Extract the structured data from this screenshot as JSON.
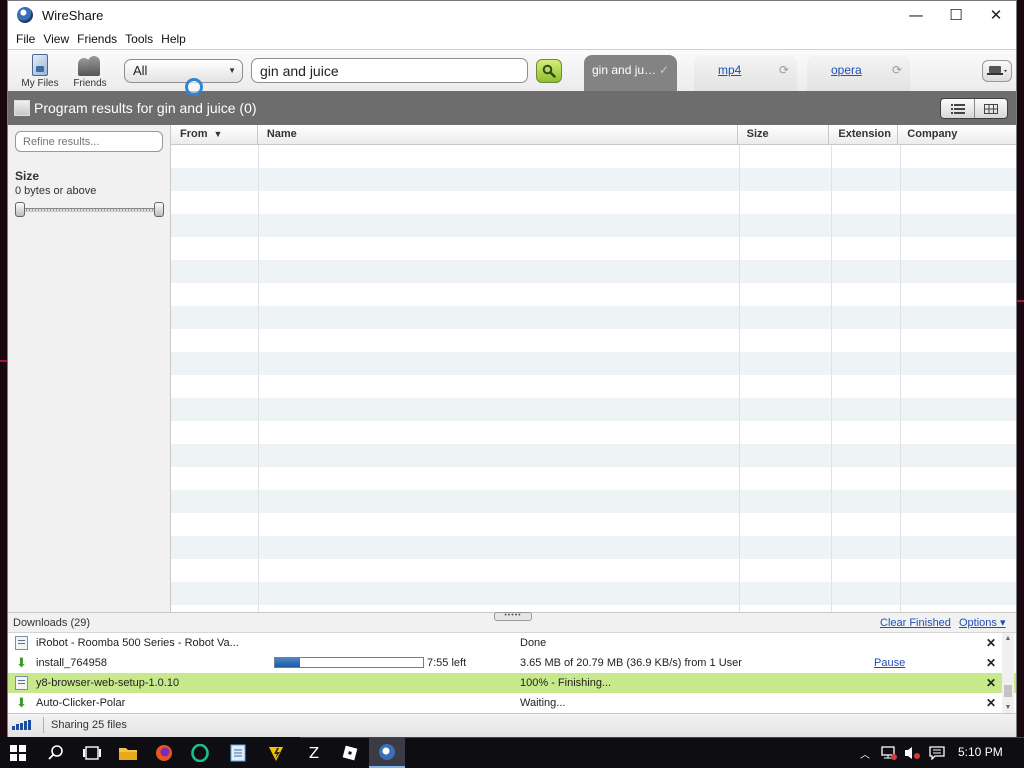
{
  "window": {
    "title": "WireShare",
    "controls": {
      "minimize": "—",
      "maximize": "☐",
      "close": "✕"
    }
  },
  "menu": [
    "File",
    "View",
    "Friends",
    "Tools",
    "Help"
  ],
  "toolbar": {
    "my_files_label": "My Files",
    "friends_label": "Friends",
    "category_value": "All",
    "search_value": "gin and juice",
    "tabs": [
      {
        "label": "gin and ju…",
        "status": "✓",
        "active": true
      },
      {
        "label": "mp4",
        "status": "⟳",
        "active": false
      },
      {
        "label": "opera",
        "status": "⟳",
        "active": false
      }
    ]
  },
  "results": {
    "title": "Program results for gin and juice (0)"
  },
  "filters": {
    "refine_placeholder": "Refine results...",
    "size_title": "Size",
    "size_subtitle": "0 bytes or above"
  },
  "table": {
    "columns": [
      {
        "label": "From",
        "sorted": true,
        "sort_glyph": "▼"
      },
      {
        "label": "Name"
      },
      {
        "label": "Size"
      },
      {
        "label": "Extension"
      },
      {
        "label": "Company"
      }
    ],
    "rows": []
  },
  "downloads": {
    "title": "Downloads (29)",
    "grip": "•••••",
    "clear_finished": "Clear Finished",
    "options": "Options ▾",
    "items": [
      {
        "name": "iRobot - Roomba 500 Series - Robot Va...",
        "status": "Done",
        "icon": "document-icon",
        "close": "✕"
      },
      {
        "name": "install_764958",
        "status": "3.65 MB of 20.79 MB (36.9 KB/s) from 1 User",
        "icon": "download-arrow-icon",
        "progress": 0.17,
        "time_left": "7:55 left",
        "action": "Pause",
        "close": "✕"
      },
      {
        "name": "y8-browser-web-setup-1.0.10",
        "status": "100% - Finishing...",
        "icon": "document-icon",
        "selected": true,
        "close": "✕"
      },
      {
        "name": "Auto-Clicker-Polar",
        "status": "Waiting...",
        "icon": "download-arrow-icon",
        "close": "✕"
      }
    ]
  },
  "statusbar": {
    "sharing_text": "Sharing 25 files"
  },
  "taskbar": {
    "clock": "5:10 PM",
    "apps": [
      "start-icon",
      "search-icon",
      "task-view-icon",
      "file-explorer-icon",
      "firefox-icon",
      "opera-icon",
      "notepad-icon",
      "bolt-app-icon",
      "zotero-icon",
      "roblox-icon",
      "wireshare-icon"
    ]
  },
  "colors": {
    "accent_green": "#c7e98c",
    "header_gray": "#6d6d6d",
    "link_blue": "#1e4fb8",
    "progress_blue": "#1d5aa0"
  }
}
